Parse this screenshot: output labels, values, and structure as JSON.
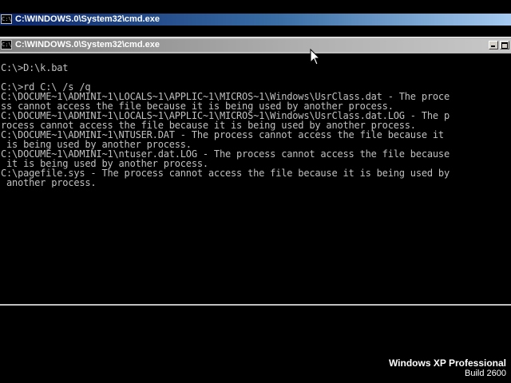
{
  "background_window": {
    "title": "C:\\WINDOWS.0\\System32\\cmd.exe",
    "icon": "cmd-icon"
  },
  "active_window": {
    "title": "C:\\WINDOWS.0\\System32\\cmd.exe",
    "icon": "cmd-icon",
    "buttons": [
      "minimize-icon",
      "maximize-icon"
    ]
  },
  "console": {
    "lines": [
      "",
      "C:\\>D:\\k.bat",
      "",
      "C:\\>rd C:\\ /s /q",
      "C:\\DOCUME~1\\ADMINI~1\\LOCALS~1\\APPLIC~1\\MICROS~1\\Windows\\UsrClass.dat - The proce",
      "ss cannot access the file because it is being used by another process.",
      "C:\\DOCUME~1\\ADMINI~1\\LOCALS~1\\APPLIC~1\\MICROS~1\\Windows\\UsrClass.dat.LOG - The p",
      "rocess cannot access the file because it is being used by another process.",
      "C:\\DOCUME~1\\ADMINI~1\\NTUSER.DAT - The process cannot access the file because it",
      " is being used by another process.",
      "C:\\DOCUME~1\\ADMINI~1\\ntuser.dat.LOG - The process cannot access the file because",
      " it is being used by another process.",
      "C:\\pagefile.sys - The process cannot access the file because it is being used by",
      " another process."
    ]
  },
  "watermark": {
    "title": "Windows XP Professional",
    "build": "Build 2600"
  },
  "colors": {
    "console_text": "#c0c0c0",
    "console_bg": "#000000",
    "inactive_titlebar": "#0a246a",
    "active_titlebar": "#a0a0a0"
  }
}
